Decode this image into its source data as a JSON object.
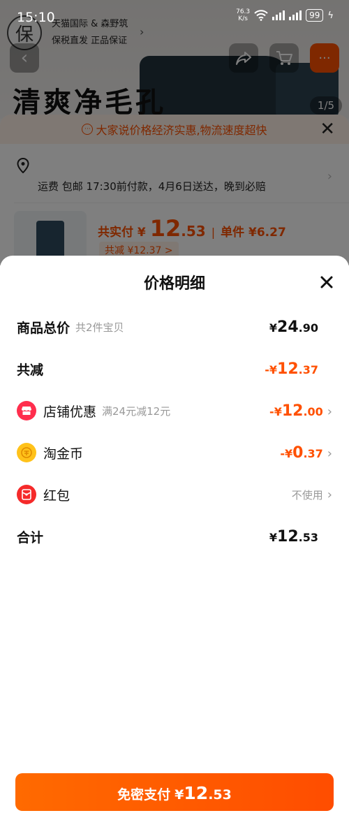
{
  "status_bar": {
    "time": "15:10",
    "net_speed_value": "76.3",
    "net_speed_unit": "K/s",
    "battery": "99"
  },
  "background": {
    "shop_name": "天猫国际 & 森野筑",
    "shop_tagline": "保税直发  正品保证",
    "seal_char": "保",
    "product_title": "清爽净毛孔",
    "image_counter": "1/5",
    "review_banner": "大家说价格经济实惠,物流速度超快",
    "shipping_text": "运费 包邮 17:30前付款，4月6日送达，晚到必赔",
    "price_label": "共实付 ¥",
    "price_int": "12",
    "price_dec": ".53",
    "unit_price": "单件 ¥6.27",
    "discount_chip": "共减 ¥12.37 >"
  },
  "sheet": {
    "title": "价格明细",
    "rows": {
      "total": {
        "label": "商品总价",
        "sub": "共2件宝贝",
        "prefix": "¥",
        "int": "24",
        "dec": ".90"
      },
      "reduced": {
        "label": "共减",
        "prefix": "-¥",
        "int": "12",
        "dec": ".37"
      },
      "shop_discount": {
        "label": "店铺优惠",
        "sub": "满24元减12元",
        "prefix": "-¥",
        "int": "12",
        "dec": ".00"
      },
      "coins": {
        "label": "淘金币",
        "prefix": "-¥",
        "int": "0",
        "dec": ".37"
      },
      "red_packet": {
        "label": "红包",
        "value": "不使用"
      },
      "sum": {
        "label": "合计",
        "prefix": "¥",
        "int": "12",
        "dec": ".53"
      }
    }
  },
  "pay_button": {
    "label": "免密支付",
    "prefix": "¥",
    "int": "12",
    "dec": ".53"
  },
  "colors": {
    "accent": "#ff5000",
    "shop_icon": "#ff2e4d",
    "coin_icon": "#ffc21a",
    "red_packet_icon": "#f52a2a"
  }
}
